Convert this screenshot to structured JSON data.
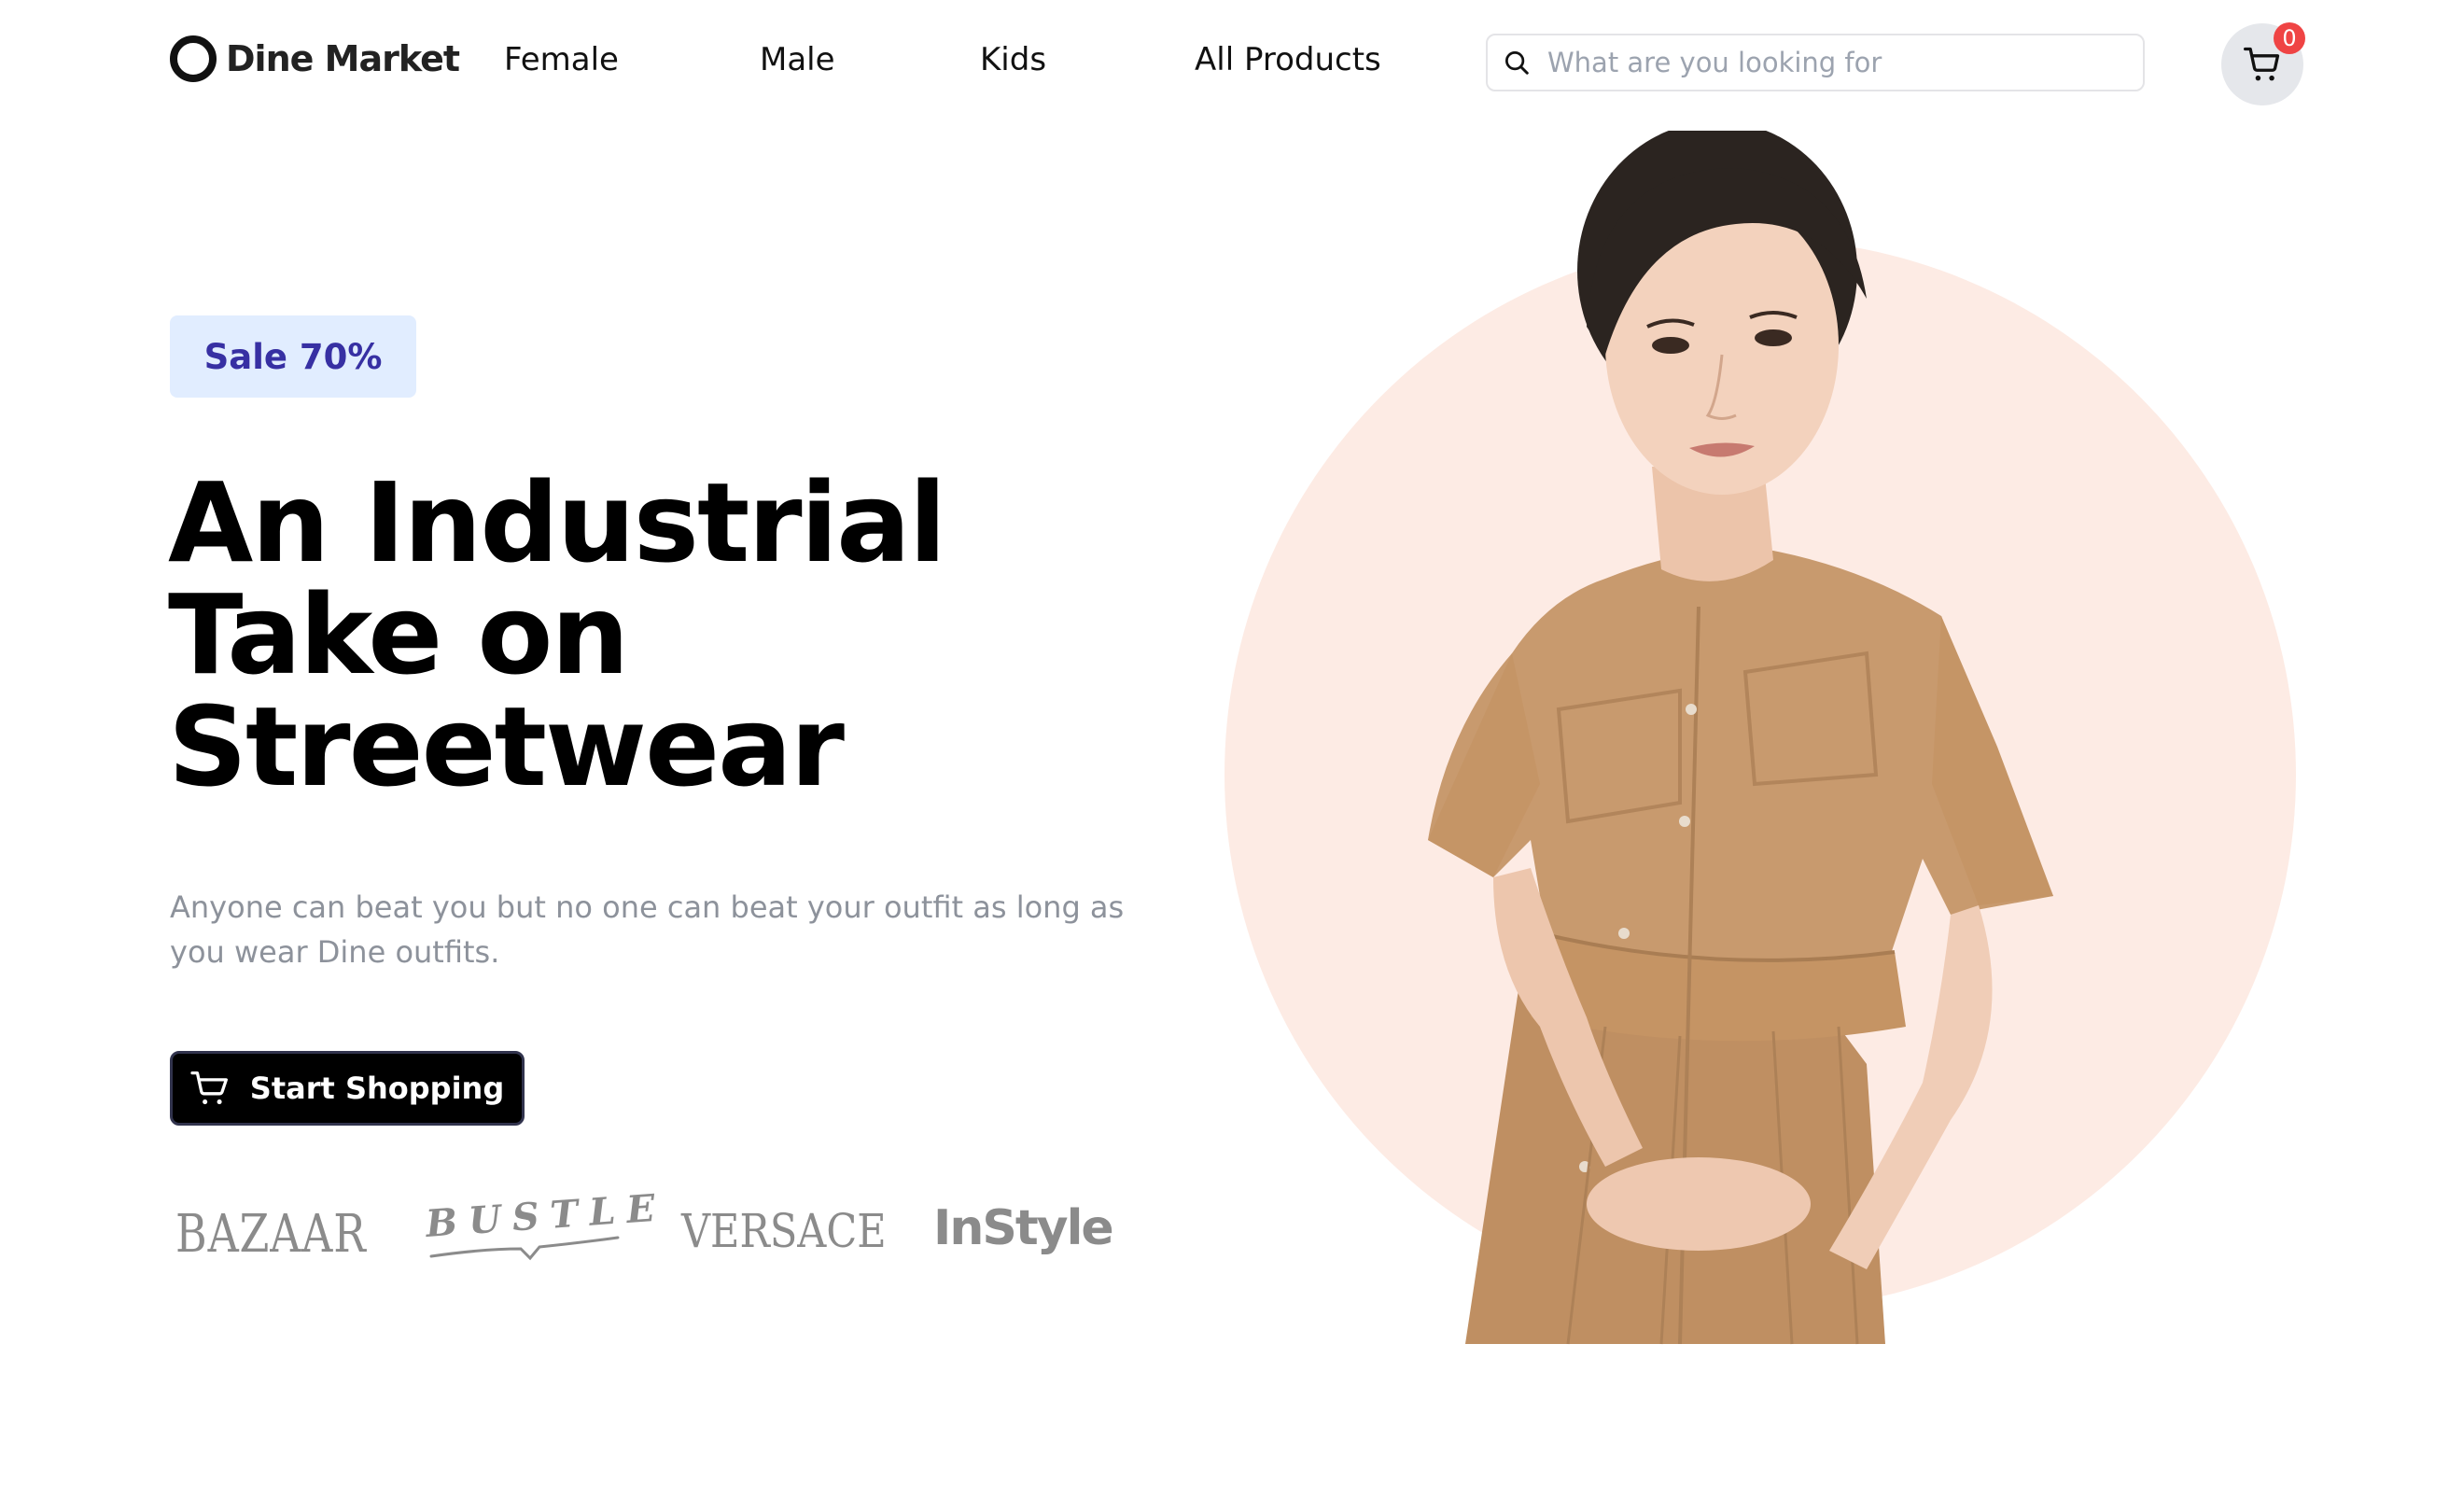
{
  "header": {
    "logo": {
      "icon": "ring-icon",
      "text": "Dine Market"
    },
    "nav": [
      {
        "label": "Female"
      },
      {
        "label": "Male"
      },
      {
        "label": "Kids"
      },
      {
        "label": "All Products"
      }
    ],
    "search": {
      "icon": "search-icon",
      "value": "",
      "placeholder": "What are you looking for"
    },
    "cart": {
      "icon": "cart-icon",
      "count": "0"
    }
  },
  "hero": {
    "badge": "Sale 70%",
    "title_lines": [
      "An Industrial",
      "Take on",
      "Streetwear"
    ],
    "description": "Anyone can beat you but no one can beat your outfit as long as you wear Dine outfits.",
    "cta": {
      "icon": "cart-icon",
      "label": "Start Shopping"
    },
    "brands": [
      "BAZAAR",
      "BUSTLE",
      "VERSACE",
      "InStyle"
    ],
    "image": {
      "subject": "model-in-beige-shirt-dress",
      "backdrop_color": "#fdebe4",
      "dress_color": "#c89a6e"
    }
  },
  "colors": {
    "badge_bg": "#e1edff",
    "badge_text": "#3730a3",
    "cta_bg": "#000000",
    "cart_badge": "#ef4444",
    "muted_text": "#8d929b"
  }
}
